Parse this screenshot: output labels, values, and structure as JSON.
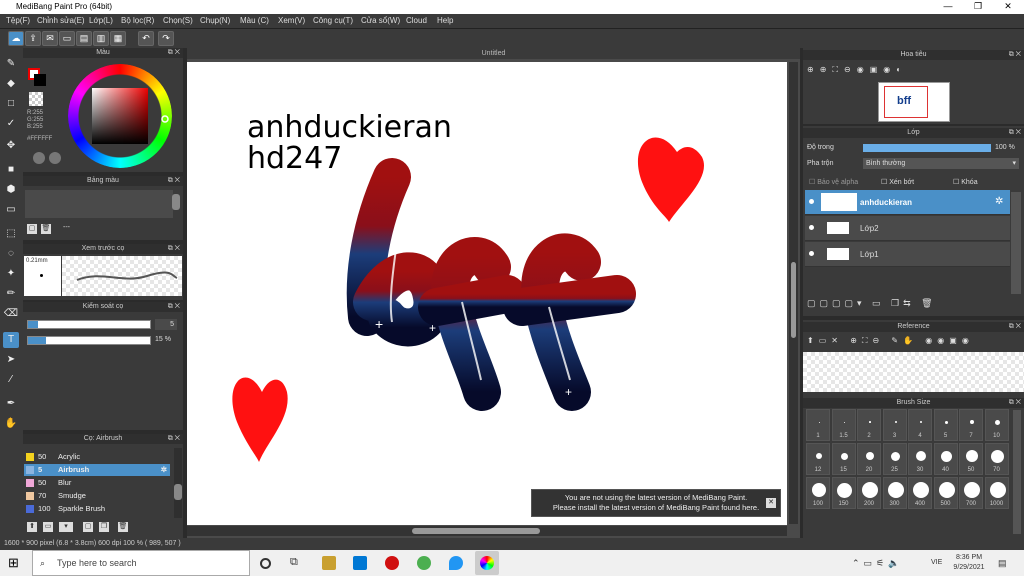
{
  "window": {
    "title": "MediBang Paint Pro (64bit)",
    "minimize": "—",
    "maximize": "❐",
    "close": "✕"
  },
  "menu": [
    "Tệp(F)",
    "Chỉnh sửa(E)",
    "Lớp(L)",
    "Bộ lọc(R)",
    "Chọn(S)",
    "Chụp(N)",
    "Màu (C)",
    "Xem(V)",
    "Công cụ(T)",
    "Cửa sổ(W)",
    "Cloud",
    "Help"
  ],
  "panels": {
    "color": {
      "title": "Màu",
      "r": "R:255",
      "g": "G:255",
      "b": "B:255",
      "hex": "#FFFFFF"
    },
    "palette": {
      "title": "Bảng màu",
      "dash": "---"
    },
    "brush_preview": {
      "title": "Xem trước cọ",
      "size": "0.21mm"
    },
    "brush_control": {
      "title": "Kiểm soát cọ",
      "size_value": "5",
      "opacity_value": "15 %"
    },
    "brush_list": {
      "title": "Cọ: Airbrush",
      "items": [
        {
          "size": "50",
          "name": "Acrylic",
          "color": "#f4d21e"
        },
        {
          "size": "5",
          "name": "Airbrush",
          "color": "#8ab4e0"
        },
        {
          "size": "50",
          "name": "Blur",
          "color": "#f0a8d8"
        },
        {
          "size": "70",
          "name": "Smudge",
          "color": "#f0c8a0"
        },
        {
          "size": "100",
          "name": "Sparkle Brush",
          "color": "#4a6ad8"
        }
      ]
    },
    "navigator": {
      "title": "Hoa tiêu"
    },
    "layer": {
      "title": "Lớp",
      "opacity_label": "Độ trong",
      "opacity_value": "100 %",
      "blend_label": "Pha trộn",
      "blend_value": "Bình thường",
      "alpha": "Bảo vệ alpha",
      "clip": "Xén bớt",
      "lock": "Khóa",
      "layers": [
        {
          "name": "anhduckieran"
        },
        {
          "name": "Lớp2"
        },
        {
          "name": "Lớp1"
        }
      ]
    },
    "reference": {
      "title": "Reference"
    },
    "brush_size": {
      "title": "Brush Size",
      "sizes": [
        "1",
        "1.5",
        "2",
        "3",
        "4",
        "5",
        "7",
        "10",
        "12",
        "15",
        "20",
        "25",
        "30",
        "40",
        "50",
        "70",
        "100",
        "150",
        "200",
        "300",
        "400",
        "500",
        "700",
        "1000"
      ]
    }
  },
  "canvas": {
    "tab": "Untitled",
    "text_line1": "anhduckieran",
    "text_line2": "hd247",
    "art": "bff"
  },
  "banner": {
    "line1": "You are not using the latest version of MediBang Paint.",
    "line2": "Please install the latest version of MediBang Paint found here.",
    "close": "✕"
  },
  "status": {
    "text": "1600 * 900 pixel  (6.8 * 3.8cm)  600 dpi  100 %  ( 989, 507 )"
  },
  "taskbar": {
    "search_placeholder": "Type here to search",
    "lang": "VIE",
    "time": "8:36 PM",
    "date": "9/29/2021"
  }
}
